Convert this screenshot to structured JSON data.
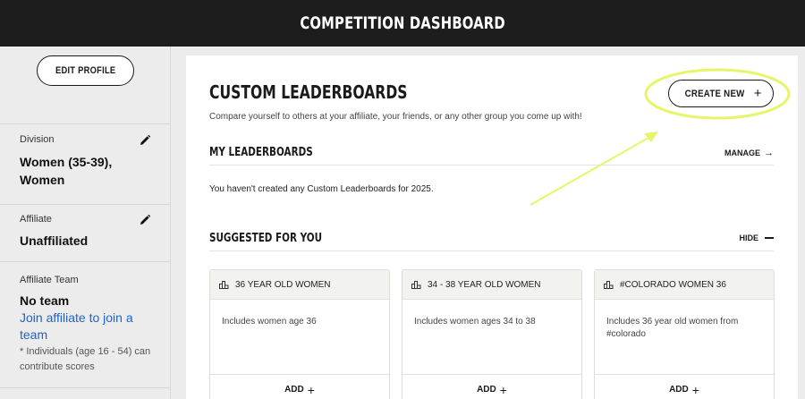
{
  "header": {
    "title": "COMPETITION DASHBOARD"
  },
  "sidebar": {
    "edit_profile_label": "EDIT PROFILE",
    "division": {
      "label": "Division",
      "value_line1": "Women (35-39),",
      "value_line2": "Women"
    },
    "affiliate": {
      "label": "Affiliate",
      "value": "Unaffiliated"
    },
    "affiliate_team": {
      "label": "Affiliate Team",
      "value": "No team",
      "link_line1": "Join affiliate to join a",
      "link_line2": "team",
      "note_line1": "* Individuals (age 16 - 54) can",
      "note_line2": "contribute scores"
    }
  },
  "main": {
    "title": "CUSTOM LEADERBOARDS",
    "subtitle": "Compare yourself to others at your affiliate, your friends, or any other group you come up with!",
    "create_new_label": "CREATE NEW",
    "plus_symbol": "+",
    "my_leaderboards": {
      "heading": "MY LEADERBOARDS",
      "action_label": "MANAGE",
      "action_symbol": "→",
      "empty_text": "You haven't created any Custom Leaderboards for 2025."
    },
    "suggested": {
      "heading": "SUGGESTED FOR YOU",
      "action_label": "HIDE",
      "cards": [
        {
          "title": "36 YEAR OLD WOMEN",
          "description": "Includes women age 36",
          "add_label": "ADD"
        },
        {
          "title": "34 - 38 YEAR OLD WOMEN",
          "description": "Includes women ages 34 to 38",
          "add_label": "ADD"
        },
        {
          "title": "#COLORADO WOMEN 36",
          "description": "Includes 36 year old women from #colorado",
          "add_label": "ADD"
        }
      ]
    }
  },
  "colors": {
    "header_bg": "#1d1d1d",
    "link": "#1e63c8",
    "highlight_annotation": "#e6f56a"
  }
}
